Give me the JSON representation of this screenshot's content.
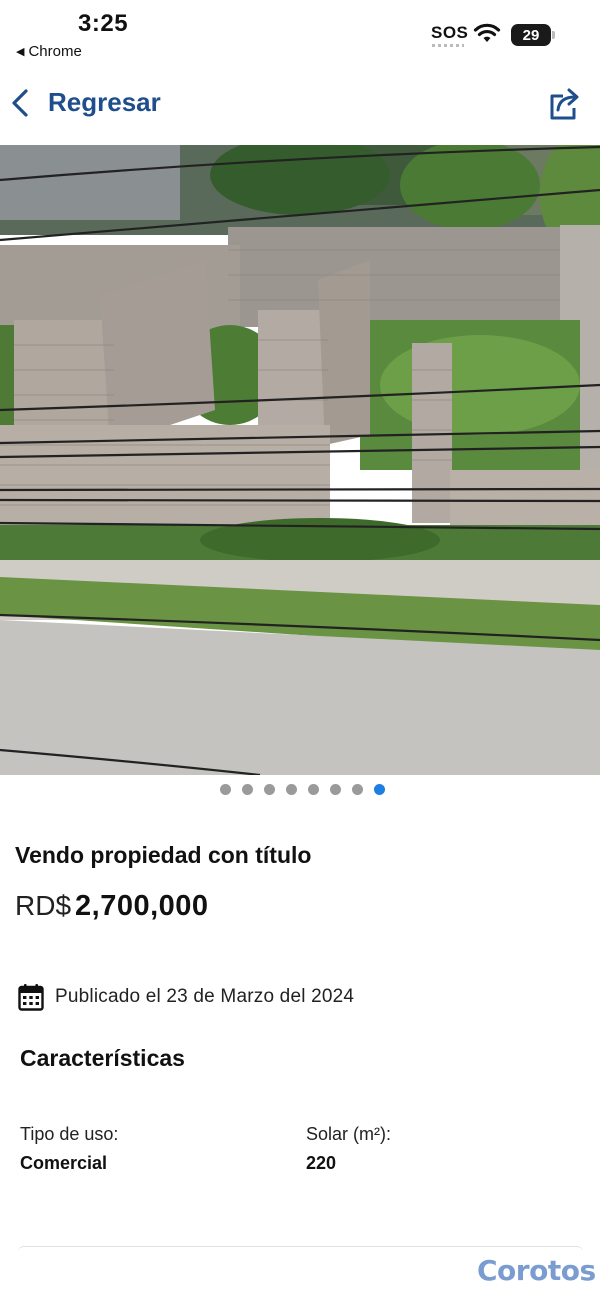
{
  "status_bar": {
    "time": "3:25",
    "back_app": "Chrome",
    "carrier": "SOS",
    "battery": "29"
  },
  "nav": {
    "back_label": "Regresar",
    "back_icon": "chevron-left-icon",
    "share_icon": "share-icon",
    "accent_color": "#1f4e8c"
  },
  "gallery": {
    "image_count": 8,
    "active_index": 7,
    "active_color": "#1e7fe0"
  },
  "listing": {
    "title": "Vendo propiedad con título",
    "currency": "RD$",
    "price": "2,700,000",
    "published": "Publicado el 23 de Marzo del 2024"
  },
  "features": {
    "heading": "Características",
    "items": [
      {
        "label": "Tipo de uso:",
        "value": "Comercial"
      },
      {
        "label": "Solar (m²):",
        "value": "220"
      }
    ]
  },
  "footer": {
    "brand": "Corotos"
  }
}
